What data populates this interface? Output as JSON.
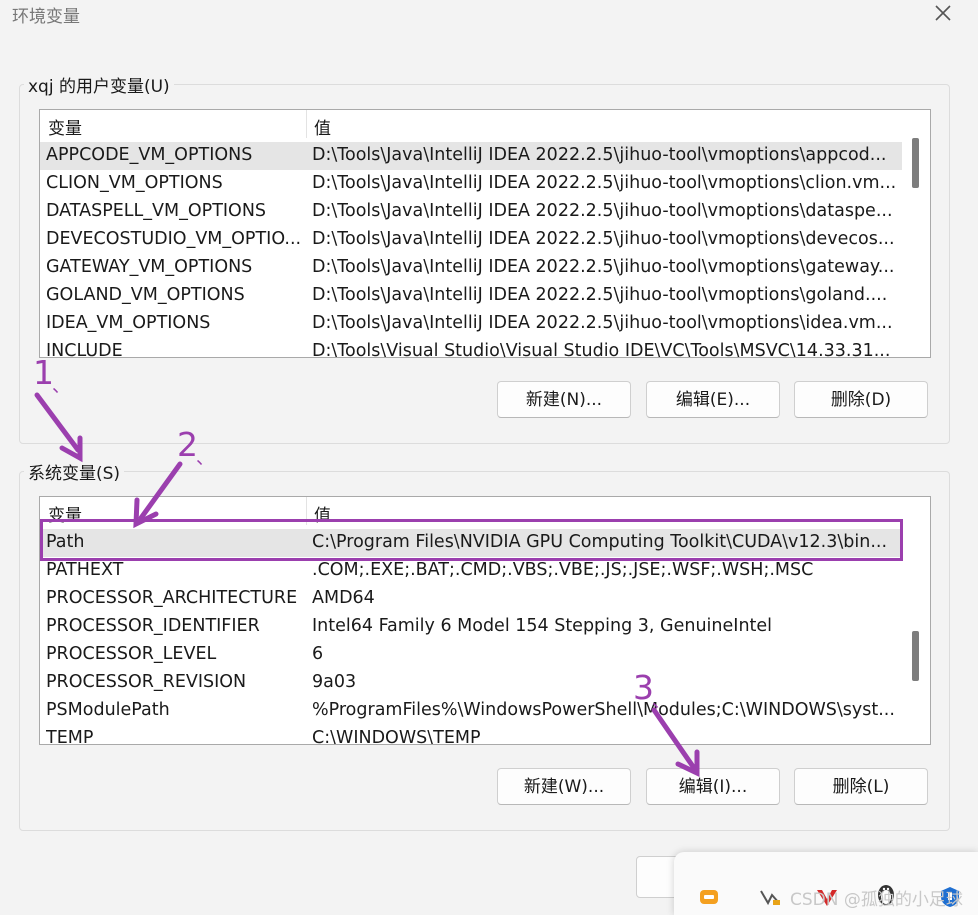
{
  "window": {
    "title": "环境变量"
  },
  "user_group": {
    "label": "xqj 的用户变量(U)",
    "columns": [
      "变量",
      "值"
    ],
    "rows": [
      {
        "name": "APPCODE_VM_OPTIONS",
        "value": "D:\\Tools\\Java\\IntelliJ IDEA 2022.2.5\\jihuo-tool\\vmoptions\\appcod..."
      },
      {
        "name": "CLION_VM_OPTIONS",
        "value": "D:\\Tools\\Java\\IntelliJ IDEA 2022.2.5\\jihuo-tool\\vmoptions\\clion.vm..."
      },
      {
        "name": "DATASPELL_VM_OPTIONS",
        "value": "D:\\Tools\\Java\\IntelliJ IDEA 2022.2.5\\jihuo-tool\\vmoptions\\dataspe..."
      },
      {
        "name": "DEVECOSTUDIO_VM_OPTIO...",
        "value": "D:\\Tools\\Java\\IntelliJ IDEA 2022.2.5\\jihuo-tool\\vmoptions\\devecos..."
      },
      {
        "name": "GATEWAY_VM_OPTIONS",
        "value": "D:\\Tools\\Java\\IntelliJ IDEA 2022.2.5\\jihuo-tool\\vmoptions\\gateway..."
      },
      {
        "name": "GOLAND_VM_OPTIONS",
        "value": "D:\\Tools\\Java\\IntelliJ IDEA 2022.2.5\\jihuo-tool\\vmoptions\\goland...."
      },
      {
        "name": "IDEA_VM_OPTIONS",
        "value": "D:\\Tools\\Java\\IntelliJ IDEA 2022.2.5\\jihuo-tool\\vmoptions\\idea.vm..."
      },
      {
        "name": "INCLUDE",
        "value": "D:\\Tools\\Visual Studio\\Visual Studio IDE\\VC\\Tools\\MSVC\\14.33.31..."
      }
    ],
    "buttons": {
      "new": "新建(N)...",
      "edit": "编辑(E)...",
      "delete": "删除(D)"
    }
  },
  "system_group": {
    "label": "系统变量(S)",
    "columns": [
      "变量",
      "值"
    ],
    "rows": [
      {
        "name": "Path",
        "value": "C:\\Program Files\\NVIDIA GPU Computing Toolkit\\CUDA\\v12.3\\bin..."
      },
      {
        "name": "PATHEXT",
        "value": ".COM;.EXE;.BAT;.CMD;.VBS;.VBE;.JS;.JSE;.WSF;.WSH;.MSC"
      },
      {
        "name": "PROCESSOR_ARCHITECTURE",
        "value": "AMD64"
      },
      {
        "name": "PROCESSOR_IDENTIFIER",
        "value": "Intel64 Family 6 Model 154 Stepping 3, GenuineIntel"
      },
      {
        "name": "PROCESSOR_LEVEL",
        "value": "6"
      },
      {
        "name": "PROCESSOR_REVISION",
        "value": "9a03"
      },
      {
        "name": "PSModulePath",
        "value": "%ProgramFiles%\\WindowsPowerShell\\Modules;C:\\WINDOWS\\syst..."
      },
      {
        "name": "TEMP",
        "value": "C:\\WINDOWS\\TEMP"
      }
    ],
    "buttons": {
      "new": "新建(W)...",
      "edit": "编辑(I)...",
      "delete": "删除(L)"
    }
  },
  "annotations": {
    "step1": "1",
    "step2": "2",
    "step3": "3",
    "sep": "、",
    "color": "#9b3fae"
  },
  "watermark": "CSDN @孤独的小足球",
  "icons": [
    "close-icon",
    "chat-tray-icon",
    "vs-tray-icon",
    "red-app-tray-icon",
    "penguin-tray-icon",
    "shield-tray-icon"
  ]
}
